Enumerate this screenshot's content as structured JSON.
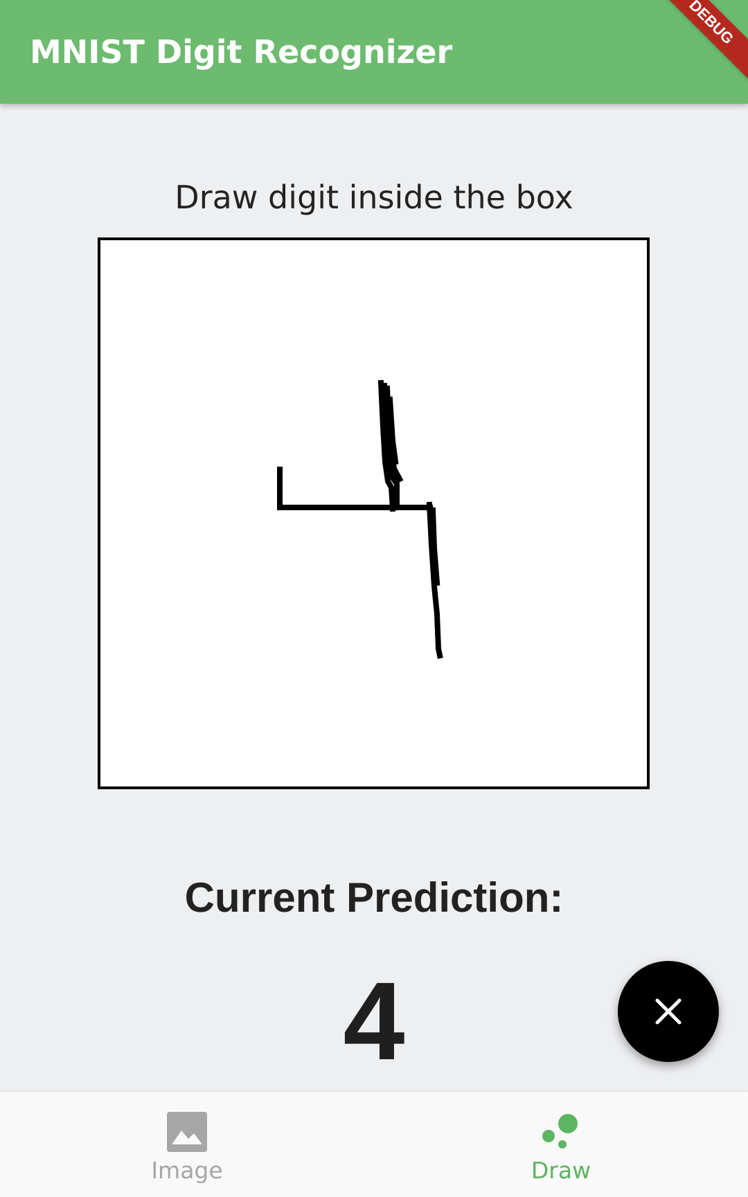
{
  "app_bar": {
    "title": "MNIST Digit Recognizer",
    "debug_banner": "DEBUG",
    "color": "#6cbb6f"
  },
  "instruction": "Draw digit inside the box",
  "prediction": {
    "label": "Current Prediction:",
    "value": "4"
  },
  "fab": {
    "icon": "close-icon"
  },
  "bottom_nav": {
    "items": [
      {
        "label": "Image",
        "icon": "image-icon",
        "selected": false
      },
      {
        "label": "Draw",
        "icon": "scatter-dots-icon",
        "selected": true
      }
    ],
    "selected_color": "#5cb560",
    "unselected_color": "#a6a6a6"
  }
}
